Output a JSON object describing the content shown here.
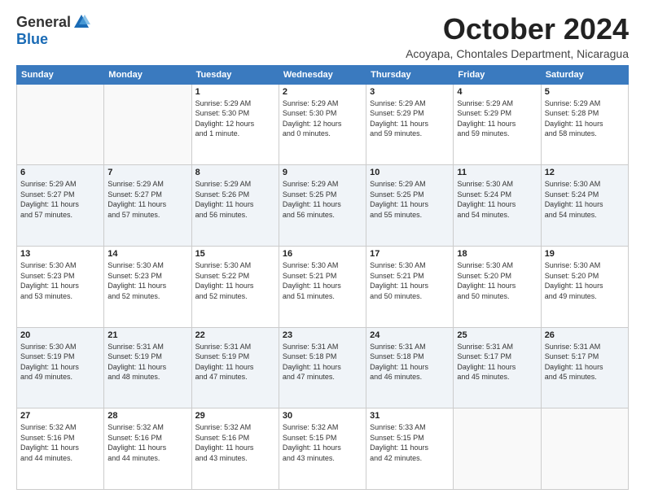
{
  "logo": {
    "general": "General",
    "blue": "Blue"
  },
  "title": "October 2024",
  "subtitle": "Acoyapa, Chontales Department, Nicaragua",
  "header_days": [
    "Sunday",
    "Monday",
    "Tuesday",
    "Wednesday",
    "Thursday",
    "Friday",
    "Saturday"
  ],
  "weeks": [
    [
      {
        "day": "",
        "info": ""
      },
      {
        "day": "",
        "info": ""
      },
      {
        "day": "1",
        "info": "Sunrise: 5:29 AM\nSunset: 5:30 PM\nDaylight: 12 hours\nand 1 minute."
      },
      {
        "day": "2",
        "info": "Sunrise: 5:29 AM\nSunset: 5:30 PM\nDaylight: 12 hours\nand 0 minutes."
      },
      {
        "day": "3",
        "info": "Sunrise: 5:29 AM\nSunset: 5:29 PM\nDaylight: 11 hours\nand 59 minutes."
      },
      {
        "day": "4",
        "info": "Sunrise: 5:29 AM\nSunset: 5:29 PM\nDaylight: 11 hours\nand 59 minutes."
      },
      {
        "day": "5",
        "info": "Sunrise: 5:29 AM\nSunset: 5:28 PM\nDaylight: 11 hours\nand 58 minutes."
      }
    ],
    [
      {
        "day": "6",
        "info": "Sunrise: 5:29 AM\nSunset: 5:27 PM\nDaylight: 11 hours\nand 57 minutes."
      },
      {
        "day": "7",
        "info": "Sunrise: 5:29 AM\nSunset: 5:27 PM\nDaylight: 11 hours\nand 57 minutes."
      },
      {
        "day": "8",
        "info": "Sunrise: 5:29 AM\nSunset: 5:26 PM\nDaylight: 11 hours\nand 56 minutes."
      },
      {
        "day": "9",
        "info": "Sunrise: 5:29 AM\nSunset: 5:25 PM\nDaylight: 11 hours\nand 56 minutes."
      },
      {
        "day": "10",
        "info": "Sunrise: 5:29 AM\nSunset: 5:25 PM\nDaylight: 11 hours\nand 55 minutes."
      },
      {
        "day": "11",
        "info": "Sunrise: 5:30 AM\nSunset: 5:24 PM\nDaylight: 11 hours\nand 54 minutes."
      },
      {
        "day": "12",
        "info": "Sunrise: 5:30 AM\nSunset: 5:24 PM\nDaylight: 11 hours\nand 54 minutes."
      }
    ],
    [
      {
        "day": "13",
        "info": "Sunrise: 5:30 AM\nSunset: 5:23 PM\nDaylight: 11 hours\nand 53 minutes."
      },
      {
        "day": "14",
        "info": "Sunrise: 5:30 AM\nSunset: 5:23 PM\nDaylight: 11 hours\nand 52 minutes."
      },
      {
        "day": "15",
        "info": "Sunrise: 5:30 AM\nSunset: 5:22 PM\nDaylight: 11 hours\nand 52 minutes."
      },
      {
        "day": "16",
        "info": "Sunrise: 5:30 AM\nSunset: 5:21 PM\nDaylight: 11 hours\nand 51 minutes."
      },
      {
        "day": "17",
        "info": "Sunrise: 5:30 AM\nSunset: 5:21 PM\nDaylight: 11 hours\nand 50 minutes."
      },
      {
        "day": "18",
        "info": "Sunrise: 5:30 AM\nSunset: 5:20 PM\nDaylight: 11 hours\nand 50 minutes."
      },
      {
        "day": "19",
        "info": "Sunrise: 5:30 AM\nSunset: 5:20 PM\nDaylight: 11 hours\nand 49 minutes."
      }
    ],
    [
      {
        "day": "20",
        "info": "Sunrise: 5:30 AM\nSunset: 5:19 PM\nDaylight: 11 hours\nand 49 minutes."
      },
      {
        "day": "21",
        "info": "Sunrise: 5:31 AM\nSunset: 5:19 PM\nDaylight: 11 hours\nand 48 minutes."
      },
      {
        "day": "22",
        "info": "Sunrise: 5:31 AM\nSunset: 5:19 PM\nDaylight: 11 hours\nand 47 minutes."
      },
      {
        "day": "23",
        "info": "Sunrise: 5:31 AM\nSunset: 5:18 PM\nDaylight: 11 hours\nand 47 minutes."
      },
      {
        "day": "24",
        "info": "Sunrise: 5:31 AM\nSunset: 5:18 PM\nDaylight: 11 hours\nand 46 minutes."
      },
      {
        "day": "25",
        "info": "Sunrise: 5:31 AM\nSunset: 5:17 PM\nDaylight: 11 hours\nand 45 minutes."
      },
      {
        "day": "26",
        "info": "Sunrise: 5:31 AM\nSunset: 5:17 PM\nDaylight: 11 hours\nand 45 minutes."
      }
    ],
    [
      {
        "day": "27",
        "info": "Sunrise: 5:32 AM\nSunset: 5:16 PM\nDaylight: 11 hours\nand 44 minutes."
      },
      {
        "day": "28",
        "info": "Sunrise: 5:32 AM\nSunset: 5:16 PM\nDaylight: 11 hours\nand 44 minutes."
      },
      {
        "day": "29",
        "info": "Sunrise: 5:32 AM\nSunset: 5:16 PM\nDaylight: 11 hours\nand 43 minutes."
      },
      {
        "day": "30",
        "info": "Sunrise: 5:32 AM\nSunset: 5:15 PM\nDaylight: 11 hours\nand 43 minutes."
      },
      {
        "day": "31",
        "info": "Sunrise: 5:33 AM\nSunset: 5:15 PM\nDaylight: 11 hours\nand 42 minutes."
      },
      {
        "day": "",
        "info": ""
      },
      {
        "day": "",
        "info": ""
      }
    ]
  ]
}
